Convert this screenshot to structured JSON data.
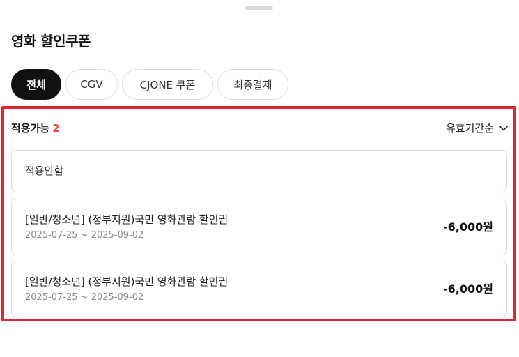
{
  "header": {
    "title": "영화 할인쿠폰"
  },
  "tabs": [
    {
      "label": "전체",
      "active": true
    },
    {
      "label": "CGV",
      "active": false
    },
    {
      "label": "CJONE 쿠폰",
      "active": false
    },
    {
      "label": "최종결제",
      "active": false
    }
  ],
  "section": {
    "label": "적용가능",
    "count": "2",
    "sort_label": "유효기간순",
    "sort_icon": "chevron-down-icon"
  },
  "no_apply": {
    "label": "적용안함"
  },
  "coupons": [
    {
      "name": "[일반/청소년] (정부지원)국민 영화관람 할인권",
      "period": "2025-07-25 ~ 2025-09-02",
      "amount": "-6,000원"
    },
    {
      "name": "[일반/청소년] (정부지원)국민 영화관람 할인권",
      "period": "2025-07-25 ~ 2025-09-02",
      "amount": "-6,000원"
    }
  ],
  "colors": {
    "accent_count": "#f0474c",
    "highlight_border": "#e0262f",
    "active_tab_bg": "#111111"
  }
}
